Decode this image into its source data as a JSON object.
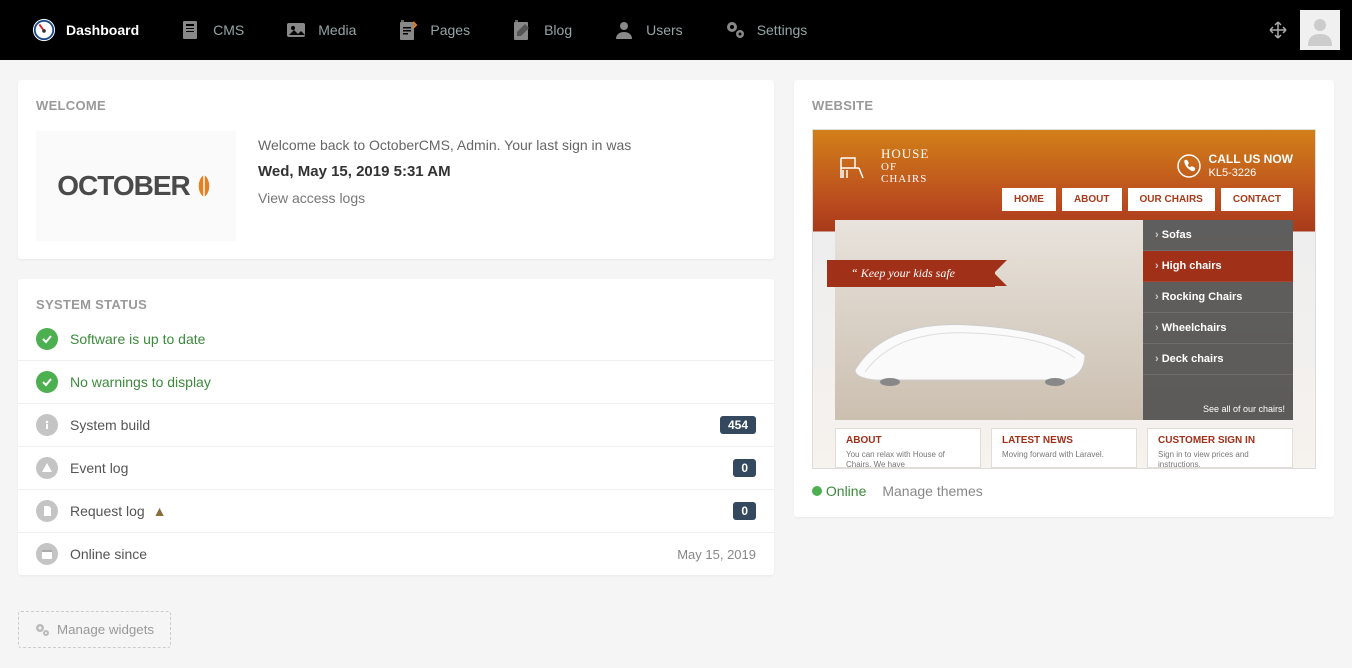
{
  "nav": {
    "items": [
      {
        "label": "Dashboard",
        "active": true
      },
      {
        "label": "CMS"
      },
      {
        "label": "Media"
      },
      {
        "label": "Pages"
      },
      {
        "label": "Blog"
      },
      {
        "label": "Users"
      },
      {
        "label": "Settings"
      }
    ]
  },
  "welcome": {
    "title": "WELCOME",
    "logo_text": "OCTOBER",
    "greeting": "Welcome back to OctoberCMS, Admin. Your last sign in was",
    "signin_date": "Wed, May 15, 2019 5:31 AM",
    "access_link": "View access logs"
  },
  "status": {
    "title": "SYSTEM STATUS",
    "rows": [
      {
        "icon": "check",
        "style": "green",
        "label": "Software is up to date",
        "green_text": true
      },
      {
        "icon": "check",
        "style": "green",
        "label": "No warnings to display",
        "green_text": true
      },
      {
        "icon": "info",
        "style": "grey",
        "label": "System build",
        "badge": "454"
      },
      {
        "icon": "alert",
        "style": "grey",
        "label": "Event log",
        "badge": "0"
      },
      {
        "icon": "file",
        "style": "grey",
        "label": "Request log",
        "warn": true,
        "badge": "0"
      },
      {
        "icon": "calendar",
        "style": "grey",
        "label": "Online since",
        "value": "May 15, 2019"
      }
    ]
  },
  "manage_widgets": "Manage widgets",
  "website": {
    "title": "WEBSITE",
    "brand_top": "HOUSE",
    "brand_mid": "OF",
    "brand_bot": "CHAIRS",
    "call_line1": "CALL US NOW",
    "call_line2": "KL5-3226",
    "tabs": [
      "HOME",
      "ABOUT",
      "OUR CHAIRS",
      "CONTACT"
    ],
    "ribbon": "Keep your kids safe",
    "cats": [
      "Sofas",
      "High chairs",
      "Rocking Chairs",
      "Wheelchairs",
      "Deck chairs"
    ],
    "active_cat_index": 1,
    "seeall": "See all of our chairs!",
    "cols": [
      {
        "h": "ABOUT",
        "p": "You can relax with House of Chairs. We have"
      },
      {
        "h": "LATEST NEWS",
        "p": "Moving forward with Laravel."
      },
      {
        "h": "CUSTOMER SIGN IN",
        "p": "Sign in to view prices and instructions."
      }
    ],
    "online": "Online",
    "manage_themes": "Manage themes"
  }
}
